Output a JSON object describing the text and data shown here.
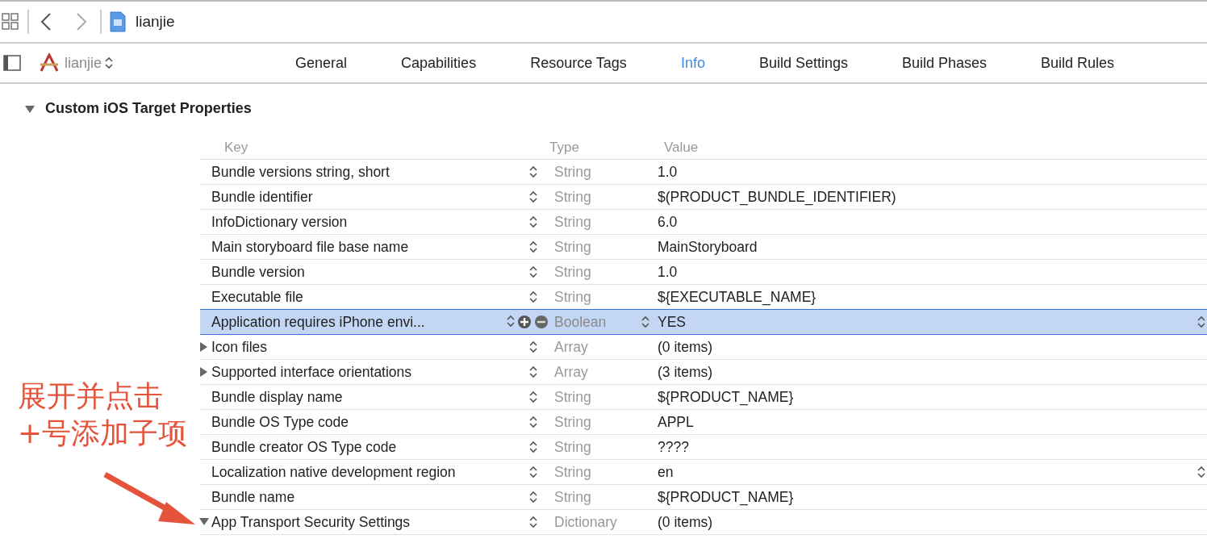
{
  "toolbar": {
    "file_name": "lianjie"
  },
  "target_bar": {
    "target": "lianjie",
    "tabs": [
      {
        "label": "General",
        "selected": false
      },
      {
        "label": "Capabilities",
        "selected": false
      },
      {
        "label": "Resource Tags",
        "selected": false
      },
      {
        "label": "Info",
        "selected": true
      },
      {
        "label": "Build Settings",
        "selected": false
      },
      {
        "label": "Build Phases",
        "selected": false
      },
      {
        "label": "Build Rules",
        "selected": false
      }
    ]
  },
  "section": {
    "title": "Custom iOS Target Properties",
    "expanded": true,
    "columns": [
      "Key",
      "Type",
      "Value"
    ],
    "rows": [
      {
        "key": "Bundle versions string, short",
        "type": "String",
        "value": "1.0",
        "kind": "leaf",
        "selected": false,
        "value_stepper": false
      },
      {
        "key": "Bundle identifier",
        "type": "String",
        "value": "$(PRODUCT_BUNDLE_IDENTIFIER)",
        "kind": "leaf",
        "selected": false,
        "value_stepper": false
      },
      {
        "key": "InfoDictionary version",
        "type": "String",
        "value": "6.0",
        "kind": "leaf",
        "selected": false,
        "value_stepper": false
      },
      {
        "key": "Main storyboard file base name",
        "type": "String",
        "value": "MainStoryboard",
        "kind": "leaf",
        "selected": false,
        "value_stepper": false
      },
      {
        "key": "Bundle version",
        "type": "String",
        "value": "1.0",
        "kind": "leaf",
        "selected": false,
        "value_stepper": false
      },
      {
        "key": "Executable file",
        "type": "String",
        "value": "${EXECUTABLE_NAME}",
        "kind": "leaf",
        "selected": false,
        "value_stepper": false
      },
      {
        "key": "Application requires iPhone envi...",
        "type": "Boolean",
        "value": "YES",
        "kind": "leaf",
        "selected": true,
        "value_stepper": true
      },
      {
        "key": "Icon files",
        "type": "Array",
        "value": "(0 items)",
        "kind": "group",
        "expanded": false,
        "selected": false,
        "value_stepper": false
      },
      {
        "key": "Supported interface orientations",
        "type": "Array",
        "value": "(3 items)",
        "kind": "group",
        "expanded": false,
        "selected": false,
        "value_stepper": false
      },
      {
        "key": "Bundle display name",
        "type": "String",
        "value": "${PRODUCT_NAME}",
        "kind": "leaf",
        "selected": false,
        "value_stepper": false
      },
      {
        "key": "Bundle OS Type code",
        "type": "String",
        "value": "APPL",
        "kind": "leaf",
        "selected": false,
        "value_stepper": false
      },
      {
        "key": "Bundle creator OS Type code",
        "type": "String",
        "value": "????",
        "kind": "leaf",
        "selected": false,
        "value_stepper": false
      },
      {
        "key": "Localization native development region",
        "type": "String",
        "value": "en",
        "kind": "leaf",
        "selected": false,
        "value_stepper": true
      },
      {
        "key": "Bundle name",
        "type": "String",
        "value": "${PRODUCT_NAME}",
        "kind": "leaf",
        "selected": false,
        "value_stepper": false
      },
      {
        "key": "App Transport Security Settings",
        "type": "Dictionary",
        "value": "(0 items)",
        "kind": "group",
        "expanded": true,
        "selected": false,
        "value_stepper": false
      }
    ]
  },
  "annotation": {
    "lines": [
      "展开并点击",
      "+号添加子项"
    ]
  }
}
